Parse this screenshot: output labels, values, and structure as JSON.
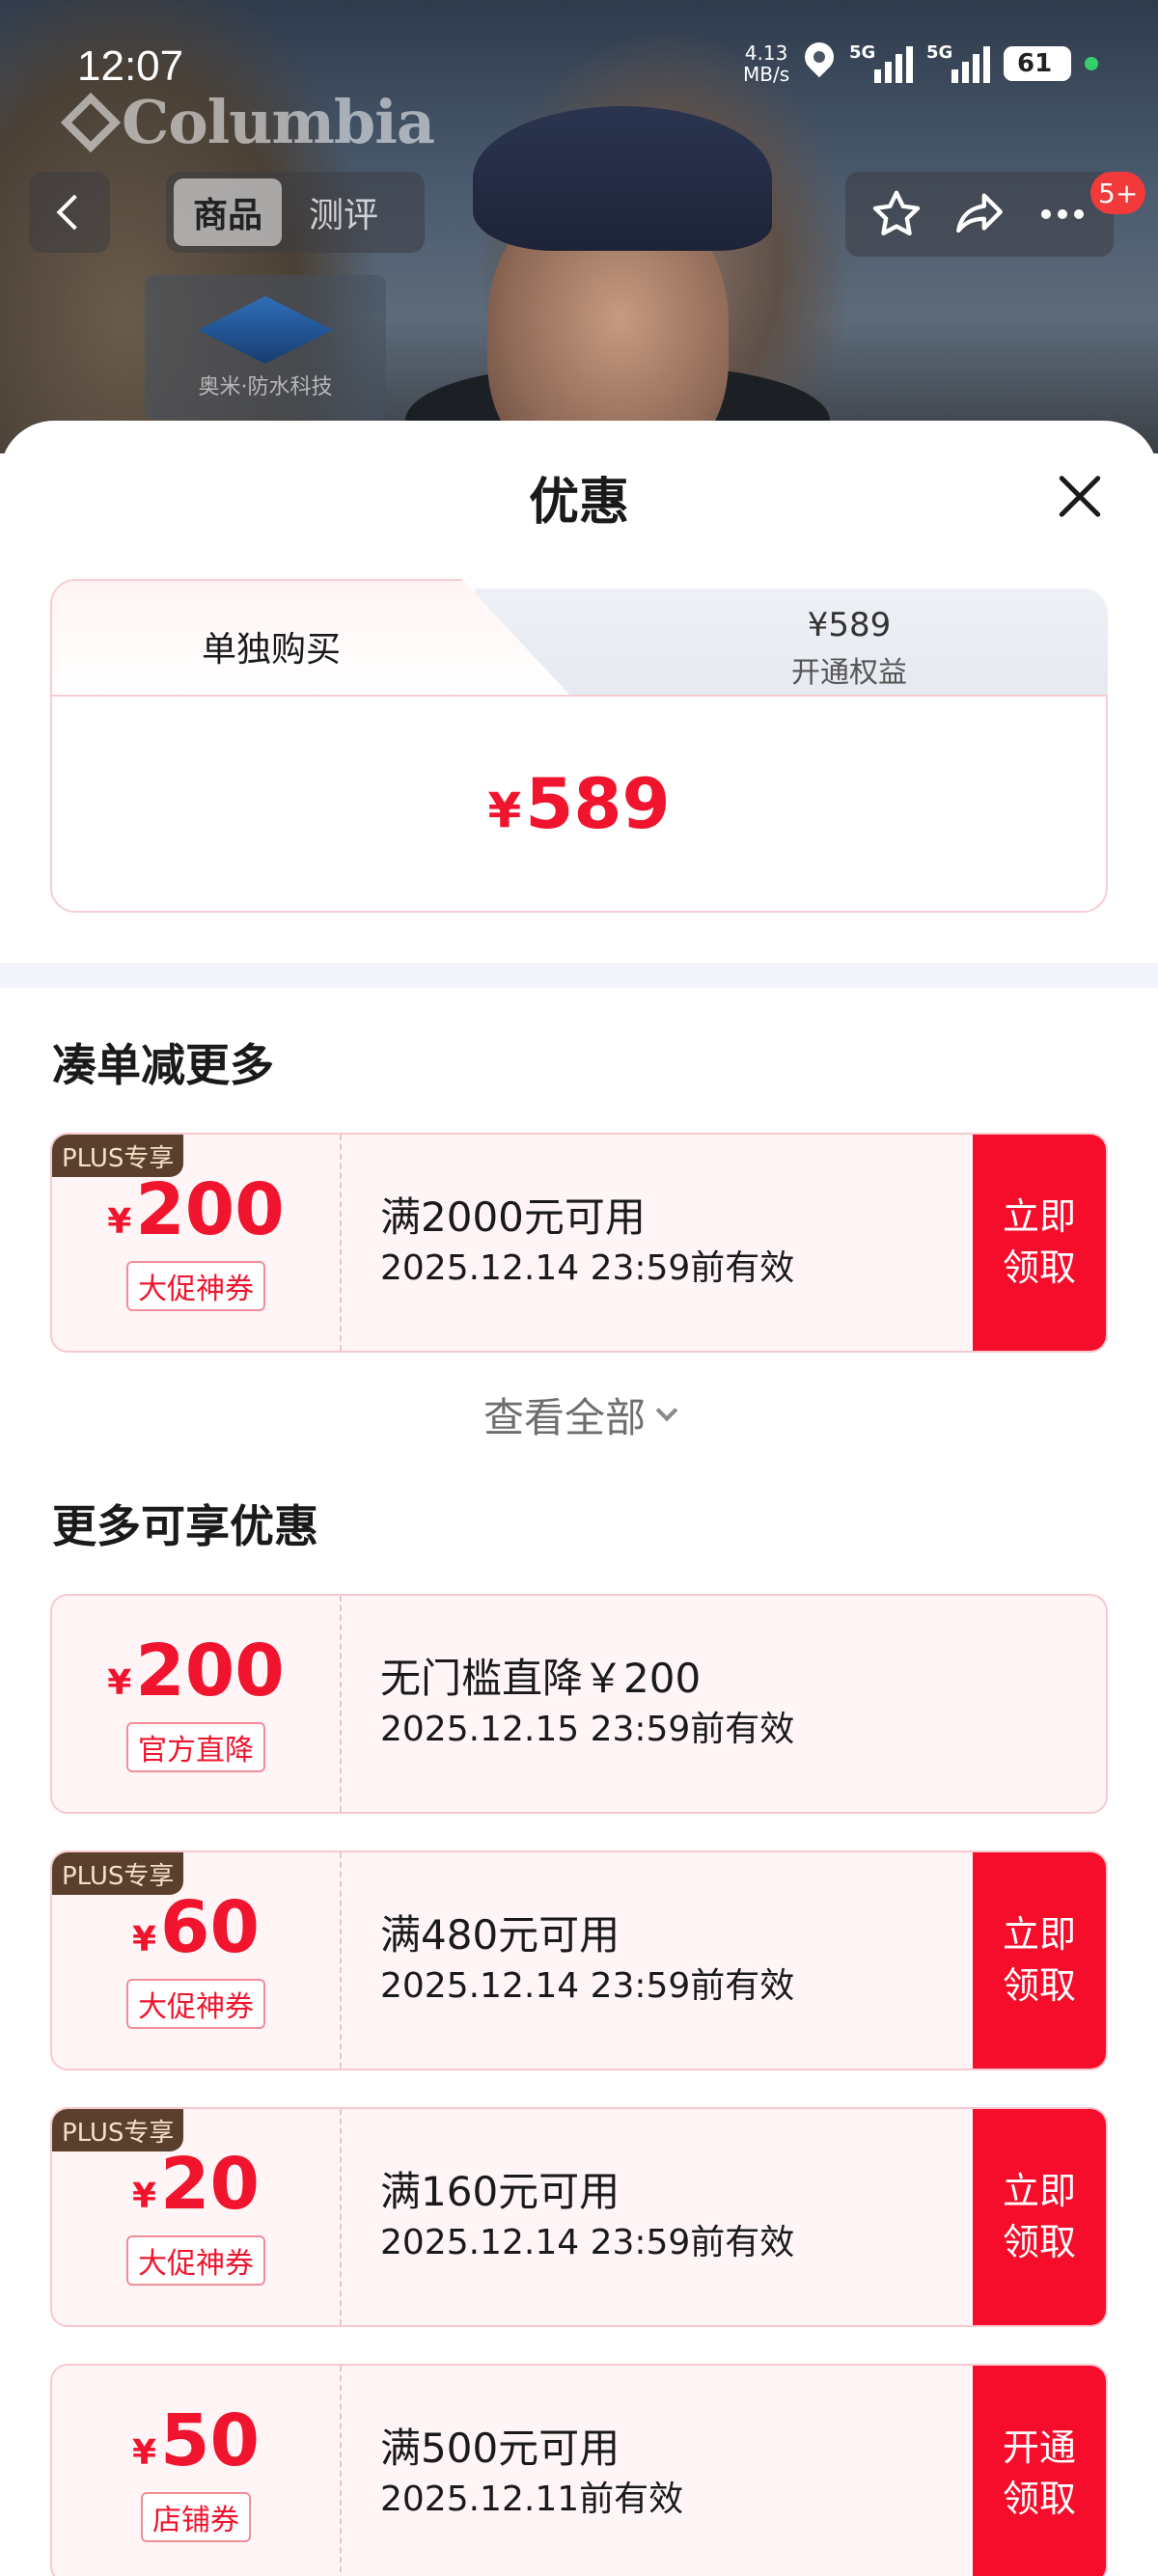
{
  "status_bar": {
    "time": "12:07",
    "speed_value": "4.13",
    "speed_unit": "MB/s",
    "network1": "5G",
    "network2": "5G",
    "battery": "61"
  },
  "hero": {
    "brand": "Columbia",
    "tech_label": "奥米·防水科技"
  },
  "nav": {
    "tabs": [
      {
        "label": "商品",
        "active": true
      },
      {
        "label": "测评",
        "active": false
      }
    ],
    "message_badge": "5+"
  },
  "sheet": {
    "title": "优惠",
    "price_tabs": {
      "main_label": "单独购买",
      "alt_price": "¥589",
      "alt_label": "开通权益"
    },
    "price": {
      "currency": "¥",
      "value": "589"
    }
  },
  "section_bundle": {
    "title": "凑单减更多",
    "coupons": [
      {
        "plus_tag": "PLUS专享",
        "currency": "¥",
        "amount": "200",
        "type": "大促神券",
        "condition": "满2000元可用",
        "expiry": "2025.12.14 23:59前有效",
        "button": "立即领取"
      }
    ],
    "view_all": "查看全部"
  },
  "section_more": {
    "title": "更多可享优惠",
    "coupons": [
      {
        "plus_tag": "",
        "currency": "¥",
        "amount": "200",
        "type": "官方直降",
        "condition": "无门槛直降￥200",
        "expiry": "2025.12.15 23:59前有效",
        "button": ""
      },
      {
        "plus_tag": "PLUS专享",
        "currency": "¥",
        "amount": "60",
        "type": "大促神券",
        "condition": "满480元可用",
        "expiry": "2025.12.14 23:59前有效",
        "button": "立即领取"
      },
      {
        "plus_tag": "PLUS专享",
        "currency": "¥",
        "amount": "20",
        "type": "大促神券",
        "condition": "满160元可用",
        "expiry": "2025.12.14 23:59前有效",
        "button": "立即领取"
      },
      {
        "plus_tag": "",
        "currency": "¥",
        "amount": "50",
        "type": "店铺券",
        "condition": "满500元可用",
        "expiry": "2025.12.11前有效",
        "button": "开通领取"
      }
    ]
  },
  "colors": {
    "accent_red": "#f0142e",
    "button_red": "#f50d2b",
    "plus_tag_bg": "#5b3f2d"
  }
}
